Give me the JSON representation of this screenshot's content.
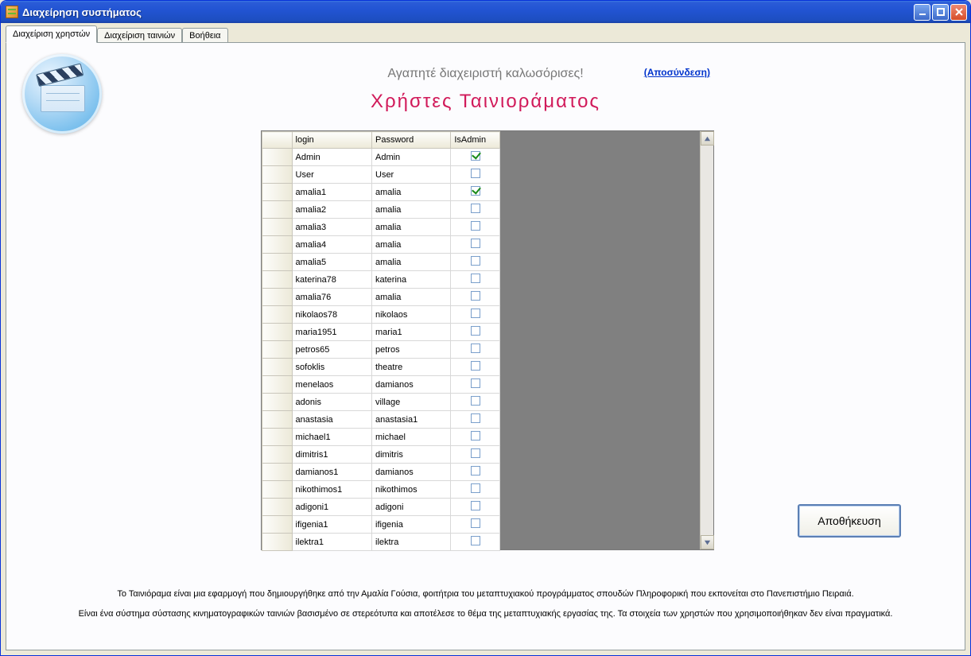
{
  "window": {
    "title": "Διαχείρηση συστήματος"
  },
  "tabs": {
    "items": [
      {
        "label": "Διαχείριση χρηστών",
        "active": true
      },
      {
        "label": "Διαχείριση ταινιών",
        "active": false
      },
      {
        "label": "Βοήθεια",
        "active": false
      }
    ]
  },
  "header": {
    "welcome": "Αγαπητέ διαχειριστή καλωσόρισες!",
    "logout": "(Αποσύνδεση)",
    "page_title": "Χρήστες  Ταινιοράματος"
  },
  "grid": {
    "columns": {
      "login": "login",
      "password": "Password",
      "isadmin": "IsAdmin"
    },
    "rows": [
      {
        "login": "Admin",
        "password": "Admin",
        "isadmin": true
      },
      {
        "login": "User",
        "password": "User",
        "isadmin": false
      },
      {
        "login": "amalia1",
        "password": "amalia",
        "isadmin": true
      },
      {
        "login": "amalia2",
        "password": "amalia",
        "isadmin": false
      },
      {
        "login": "amalia3",
        "password": "amalia",
        "isadmin": false
      },
      {
        "login": "amalia4",
        "password": "amalia",
        "isadmin": false
      },
      {
        "login": "amalia5",
        "password": "amalia",
        "isadmin": false
      },
      {
        "login": "katerina78",
        "password": "katerina",
        "isadmin": false
      },
      {
        "login": "amalia76",
        "password": "amalia",
        "isadmin": false
      },
      {
        "login": "nikolaos78",
        "password": "nikolaos",
        "isadmin": false
      },
      {
        "login": "maria1951",
        "password": "maria1",
        "isadmin": false
      },
      {
        "login": "petros65",
        "password": "petros",
        "isadmin": false
      },
      {
        "login": "sofoklis",
        "password": "theatre",
        "isadmin": false
      },
      {
        "login": "menelaos",
        "password": "damianos",
        "isadmin": false
      },
      {
        "login": "adonis",
        "password": "village",
        "isadmin": false
      },
      {
        "login": "anastasia",
        "password": "anastasia1",
        "isadmin": false
      },
      {
        "login": "michael1",
        "password": "michael",
        "isadmin": false
      },
      {
        "login": "dimitris1",
        "password": "dimitris",
        "isadmin": false
      },
      {
        "login": "damianos1",
        "password": "damianos",
        "isadmin": false
      },
      {
        "login": "nikothimos1",
        "password": "nikothimos",
        "isadmin": false
      },
      {
        "login": "adigoni1",
        "password": "adigoni",
        "isadmin": false
      },
      {
        "login": "ifigenia1",
        "password": "ifigenia",
        "isadmin": false
      },
      {
        "login": "ilektra1",
        "password": "ilektra",
        "isadmin": false
      }
    ]
  },
  "buttons": {
    "save": "Αποθήκευση"
  },
  "footer": {
    "line1": "Το Ταινιόραμα είναι μια εφαρμογή που δημιουργήθηκε από την Αμαλία Γούσια, φοιτήτρια του μεταπτυχιακού προγράμματος σπουδών Πληροφορική που εκπονείται στο Πανεπιστήμιο Πειραιά.",
    "line2": "Είναι ένα σύστημα σύστασης κινηματογραφικών ταινιών βασισμένο σε στερεότυπα και αποτέλεσε το θέμα της μεταπτυχιακής εργασίας της. Τα στοιχεία των χρηστών που χρησιμοποιήθηκαν δεν είναι πραγματικά."
  }
}
